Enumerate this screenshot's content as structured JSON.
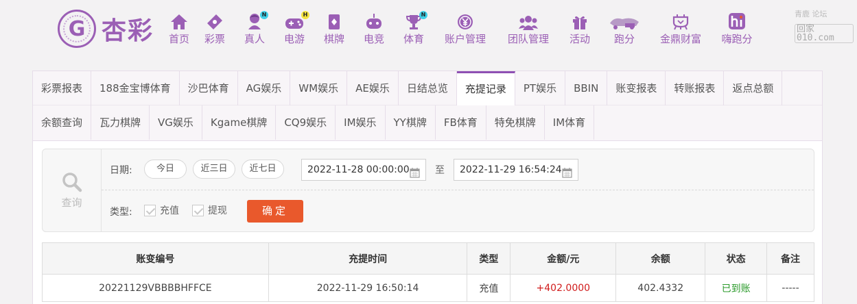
{
  "brand": {
    "name": "杏彩",
    "mark": "G"
  },
  "nav": [
    {
      "label": "首页",
      "icon": "home-icon",
      "badge": ""
    },
    {
      "label": "彩票",
      "icon": "lottery-ticket-icon",
      "badge": ""
    },
    {
      "label": "真人",
      "icon": "live-dealer-icon",
      "badge": "N"
    },
    {
      "label": "电游",
      "icon": "gamepad-icon",
      "badge": "H"
    },
    {
      "label": "棋牌",
      "icon": "cards-icon",
      "badge": ""
    },
    {
      "label": "电竞",
      "icon": "esports-icon",
      "badge": ""
    },
    {
      "label": "体育",
      "icon": "trophy-icon",
      "badge": "N"
    },
    {
      "label": "账户管理",
      "icon": "account-coin-icon",
      "badge": ""
    },
    {
      "label": "团队管理",
      "icon": "team-icon",
      "badge": ""
    },
    {
      "label": "活动",
      "icon": "gift-icon",
      "badge": ""
    },
    {
      "label": "跑分",
      "icon": "running-score-icon",
      "badge": ""
    },
    {
      "label": "金鼎财富",
      "icon": "cauldron-icon",
      "badge": ""
    },
    {
      "label": "嗨跑分",
      "icon": "hi-icon",
      "badge": ""
    }
  ],
  "watermark": {
    "line1": "青鹿  论坛",
    "site": "回家010.com"
  },
  "tabs_row1": [
    "彩票报表",
    "188金宝博体育",
    "沙巴体育",
    "AG娱乐",
    "WM娱乐",
    "AE娱乐",
    "日结总览",
    "充提记录",
    "PT娱乐",
    "BBIN",
    "账变报表",
    "转账报表",
    "返点总额"
  ],
  "tabs_row2": [
    "余额查询",
    "瓦力棋牌",
    "VG娱乐",
    "Kgame棋牌",
    "CQ9娱乐",
    "IM娱乐",
    "YY棋牌",
    "FB体育",
    "特免棋牌",
    "IM体育"
  ],
  "active_tab": "充提记录",
  "filter": {
    "query_label": "查询",
    "date_label": "日期:",
    "quick": [
      "今日",
      "近三日",
      "近七日"
    ],
    "start": "2022-11-28 00:00:00",
    "to": "至",
    "end": "2022-11-29 16:54:24",
    "type_label": "类型:",
    "types": [
      "充值",
      "提现"
    ],
    "confirm": "确定"
  },
  "table": {
    "headers": [
      "账变编号",
      "充提时间",
      "类型",
      "金额/元",
      "余额",
      "状态",
      "备注"
    ],
    "rows": [
      [
        "20221129VBBBBHFFCE",
        "2022-11-29 16:50:14",
        "充值",
        "+402.0000",
        "402.4332",
        "已到账",
        "-----"
      ]
    ]
  },
  "colors": {
    "brand": "#9b5fb5",
    "confirm": "#e9592c",
    "amount": "#d01b1b",
    "status_ok": "#2a9a2a"
  }
}
